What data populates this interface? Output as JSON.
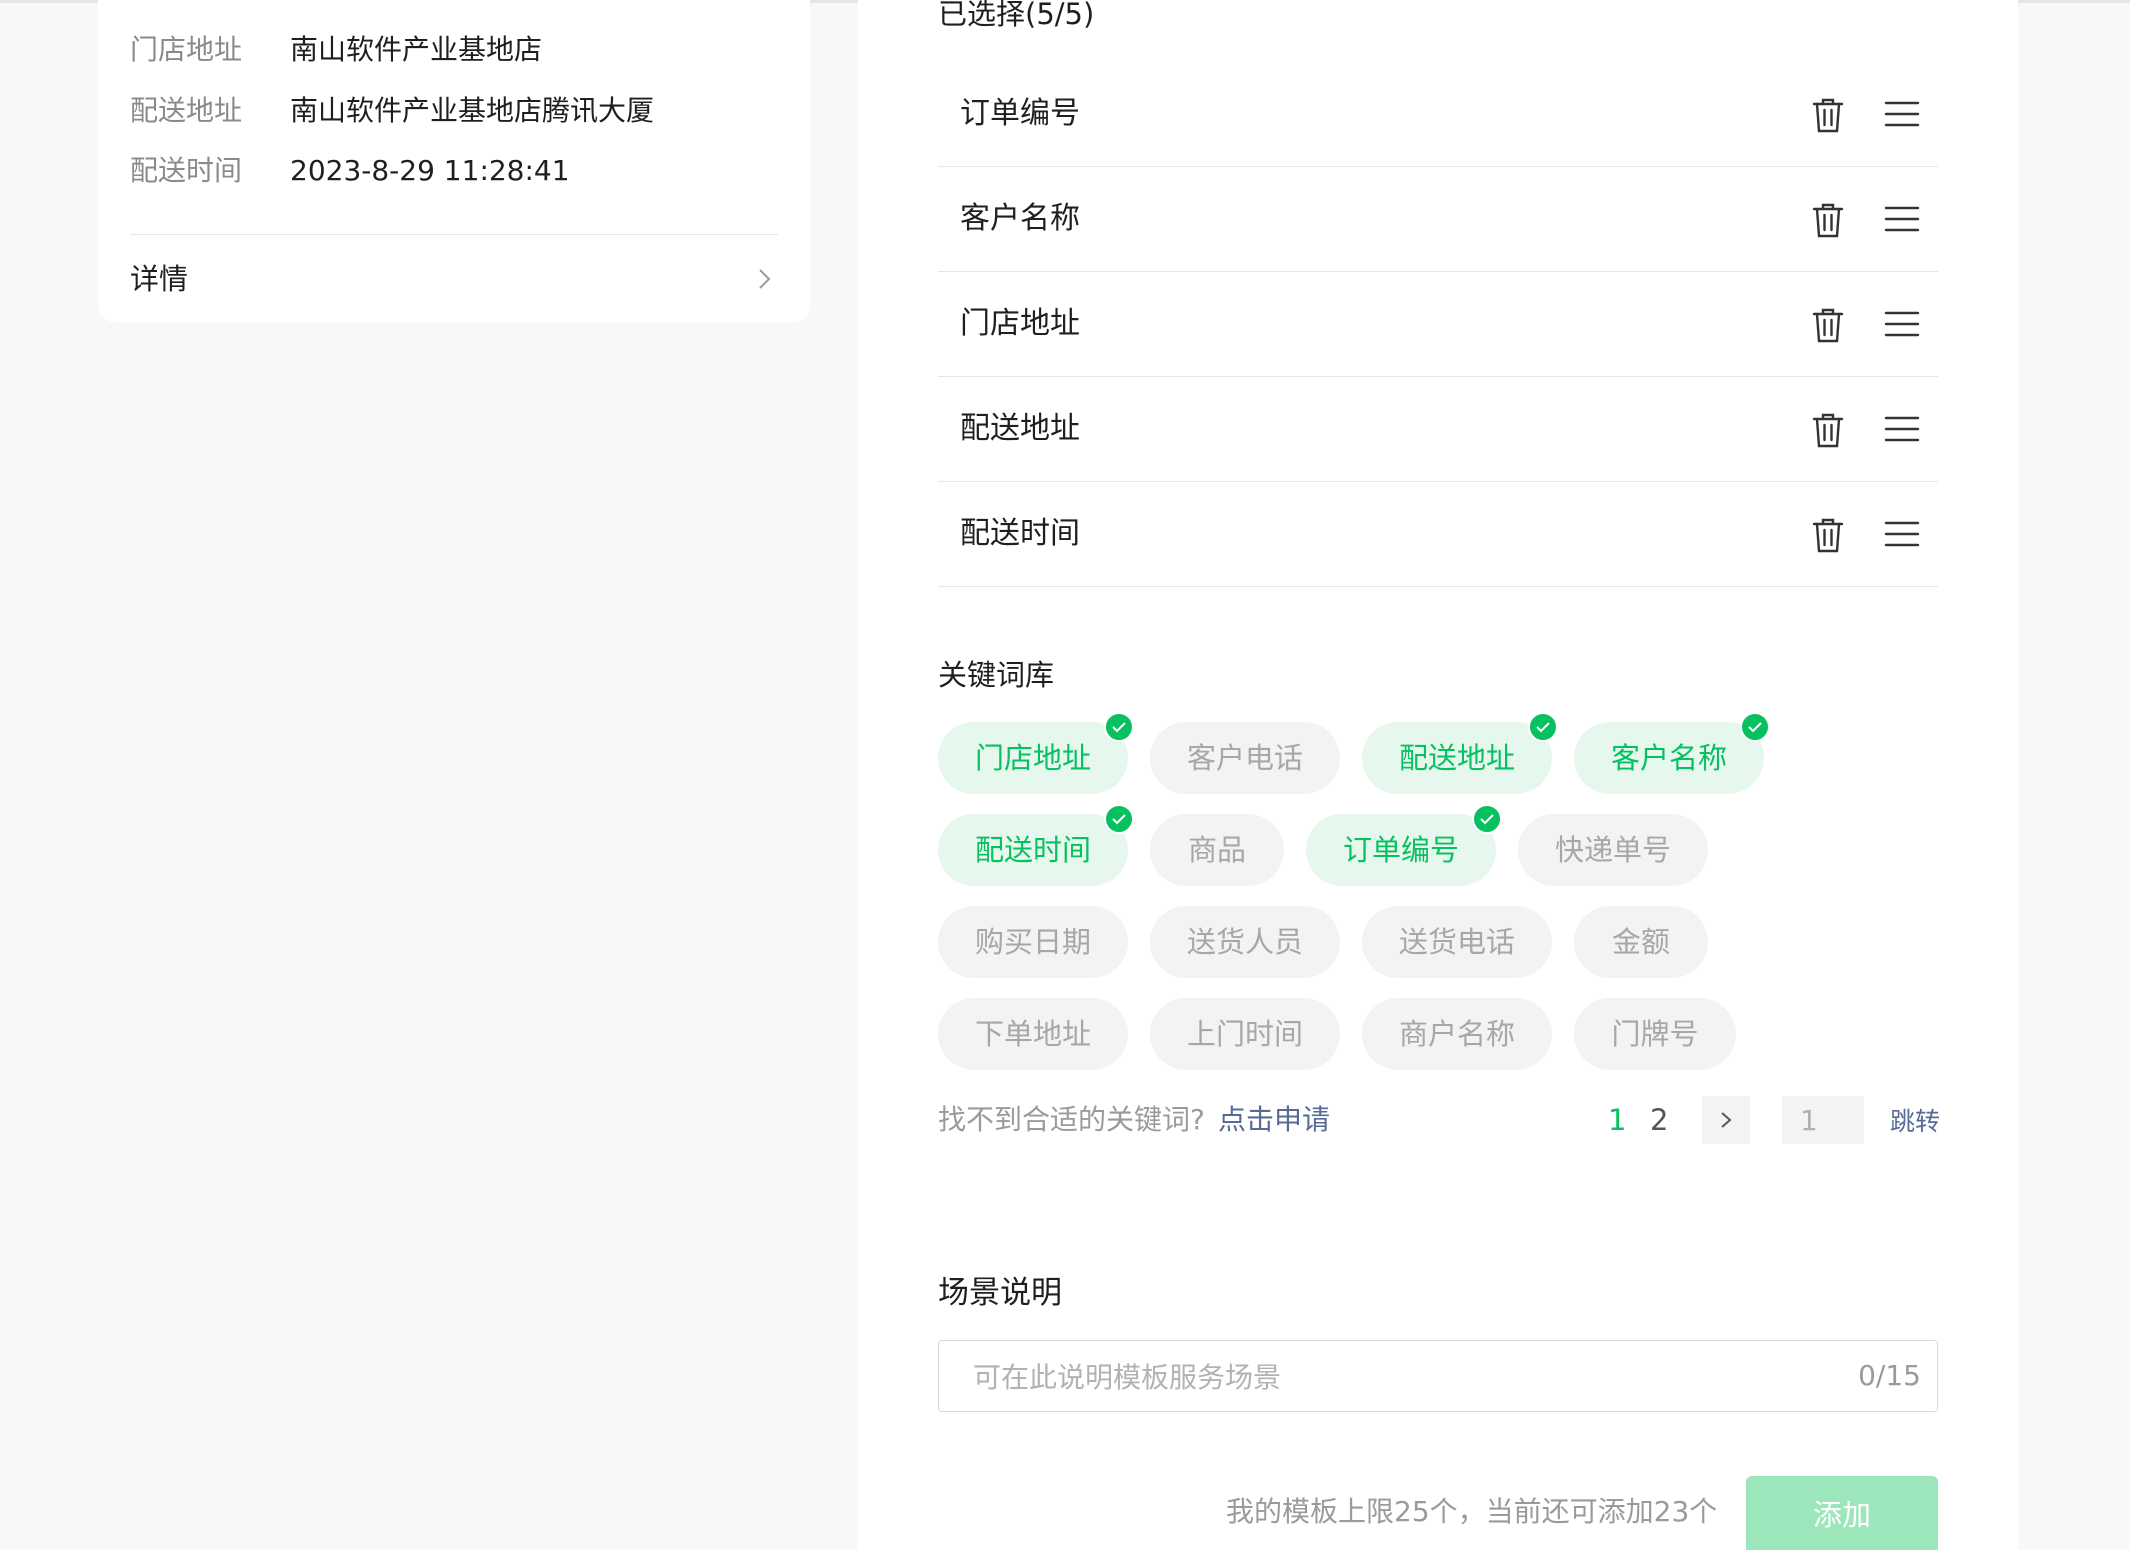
{
  "preview": {
    "rows": [
      {
        "label": "门店地址",
        "value": "南山软件产业基地店"
      },
      {
        "label": "配送地址",
        "value": "南山软件产业基地店腾讯大厦"
      },
      {
        "label": "配送时间",
        "value": "2023-8-29 11:28:41"
      }
    ],
    "details_label": "详情"
  },
  "selected": {
    "title": "已选择(5/5)",
    "items": [
      "订单编号",
      "客户名称",
      "门店地址",
      "配送地址",
      "配送时间"
    ]
  },
  "keyword_library": {
    "title": "关键词库",
    "tags": [
      {
        "label": "门店地址",
        "selected": true
      },
      {
        "label": "客户电话",
        "selected": false
      },
      {
        "label": "配送地址",
        "selected": true
      },
      {
        "label": "客户名称",
        "selected": true
      },
      {
        "label": "配送时间",
        "selected": true
      },
      {
        "label": "商品",
        "selected": false
      },
      {
        "label": "订单编号",
        "selected": true
      },
      {
        "label": "快递单号",
        "selected": false
      },
      {
        "label": "购买日期",
        "selected": false
      },
      {
        "label": "送货人员",
        "selected": false
      },
      {
        "label": "送货电话",
        "selected": false
      },
      {
        "label": "金额",
        "selected": false
      },
      {
        "label": "下单地址",
        "selected": false
      },
      {
        "label": "上门时间",
        "selected": false
      },
      {
        "label": "商户名称",
        "selected": false
      },
      {
        "label": "门牌号",
        "selected": false
      }
    ],
    "hint": "找不到合适的关键词?",
    "apply_link": "点击申请",
    "pagination": {
      "pages": [
        "1",
        "2"
      ],
      "current": "1",
      "jump_value": "1",
      "jump_label": "跳转"
    }
  },
  "scene": {
    "title": "场景说明",
    "placeholder": "可在此说明模板服务场景",
    "counter": "0/15"
  },
  "footer": {
    "limit_text": "我的模板上限25个，当前还可添加23个",
    "add_label": "添加"
  },
  "colors": {
    "accent": "#07c160",
    "accent_light": "#e6f8ed",
    "link": "#576b95",
    "button_disabled": "#9de6bb"
  }
}
